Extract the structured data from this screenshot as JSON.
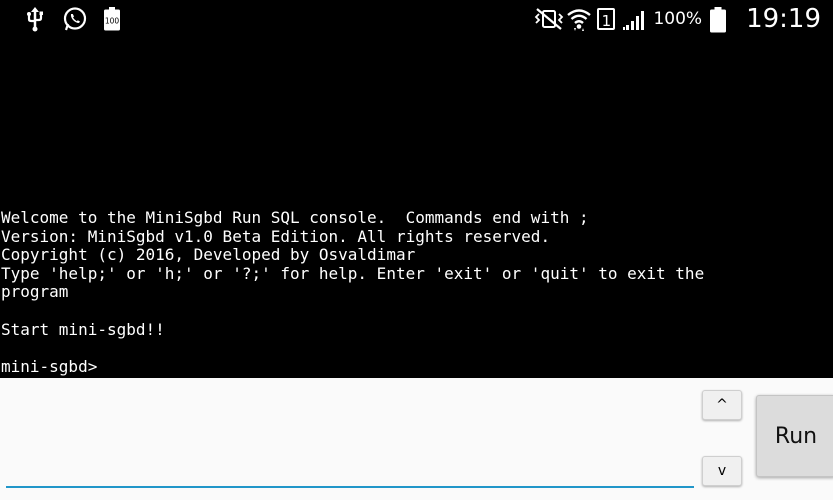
{
  "status_bar": {
    "left_icons": [
      "usb-icon",
      "whatsapp-icon",
      "battery-100-icon"
    ],
    "right_icons": [
      "vibrate-mute-icon",
      "wifi-icon",
      "sim-icon",
      "signal-icon",
      "battery-icon"
    ],
    "sim_number": "1",
    "battery_percent": "100%",
    "time": "19:19"
  },
  "console": {
    "lines": [
      "Welcome to the MiniSgbd Run SQL console.  Commands end with ;",
      "Version: MiniSgbd v1.0 Beta Edition. All rights reserved.",
      "Copyright (c) 2016, Developed by Osvaldimar",
      "Type 'help;' or 'h;' or '?;' for help. Enter 'exit' or 'quit' to exit the",
      "program",
      "",
      "Start mini-sgbd!!",
      "",
      "mini-sgbd>"
    ]
  },
  "input": {
    "value": "",
    "placeholder": ""
  },
  "buttons": {
    "history_up": "^",
    "history_down": "v",
    "run": "Run"
  },
  "colors": {
    "console_bg": "#000000",
    "console_text": "#ffffff",
    "input_underline": "#2196c9",
    "input_area_bg": "#fafafa"
  }
}
